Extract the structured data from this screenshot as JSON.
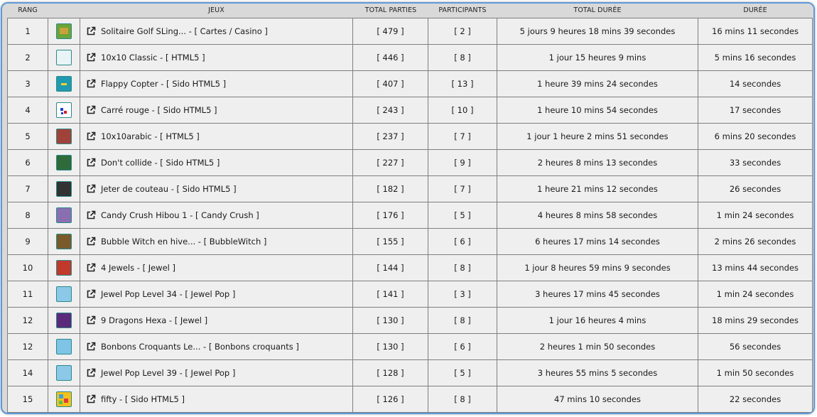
{
  "header": {
    "rang": "RANG",
    "jeux": "JEUX",
    "total_parties": "TOTAL PARTIES",
    "participants": "PARTICIPANTS",
    "total_duree": "TOTAL DURÉE",
    "duree": "DURÉE"
  },
  "rows": [
    {
      "rang": "1",
      "jeu": "Solitaire Golf SLing... - [ Cartes / Casino ]",
      "parties": "[ 479 ]",
      "participants": "[ 2 ]",
      "total_duree": "5 jours 9 heures 18 mins 39 secondes",
      "duree": "16 mins 11 secondes",
      "thumb_color": "#6aa43a"
    },
    {
      "rang": "2",
      "jeu": "10x10 Classic - [ HTML5 ]",
      "parties": "[ 446 ]",
      "participants": "[ 8 ]",
      "total_duree": "1 jour 15 heures 9 mins",
      "duree": "5 mins 16 secondes",
      "thumb_color": "#e8f4f6"
    },
    {
      "rang": "3",
      "jeu": "Flappy Copter - [ Sido HTML5 ]",
      "parties": "[ 407 ]",
      "participants": "[ 13 ]",
      "total_duree": "1 heure 39 mins 24 secondes",
      "duree": "14 secondes",
      "thumb_color": "#1f9ab0"
    },
    {
      "rang": "4",
      "jeu": "Carré rouge - [ Sido HTML5 ]",
      "parties": "[ 243 ]",
      "participants": "[ 10 ]",
      "total_duree": "1 heure 10 mins 54 secondes",
      "duree": "17 secondes",
      "thumb_color": "#ffffff"
    },
    {
      "rang": "5",
      "jeu": "10x10arabic - [ HTML5 ]",
      "parties": "[ 237 ]",
      "participants": "[ 7 ]",
      "total_duree": "1 jour 1 heure 2 mins 51 secondes",
      "duree": "6 mins 20 secondes",
      "thumb_color": "#a0413a"
    },
    {
      "rang": "6",
      "jeu": "Don't collide - [ Sido HTML5 ]",
      "parties": "[ 227 ]",
      "participants": "[ 9 ]",
      "total_duree": "2 heures 8 mins 13 secondes",
      "duree": "33 secondes",
      "thumb_color": "#2f6b3a"
    },
    {
      "rang": "7",
      "jeu": "Jeter de couteau - [ Sido HTML5 ]",
      "parties": "[ 182 ]",
      "participants": "[ 7 ]",
      "total_duree": "1 heure 21 mins 12 secondes",
      "duree": "26 secondes",
      "thumb_color": "#333333"
    },
    {
      "rang": "8",
      "jeu": "Candy Crush Hibou 1 - [ Candy Crush ]",
      "parties": "[ 176 ]",
      "participants": "[ 5 ]",
      "total_duree": "4 heures 8 mins 58 secondes",
      "duree": "1 min 24 secondes",
      "thumb_color": "#8a6fb0"
    },
    {
      "rang": "9",
      "jeu": "Bubble Witch en hive... - [ BubbleWitch ]",
      "parties": "[ 155 ]",
      "participants": "[ 6 ]",
      "total_duree": "6 heures 17 mins 14 secondes",
      "duree": "2 mins 26 secondes",
      "thumb_color": "#7a5a2a"
    },
    {
      "rang": "10",
      "jeu": "4 Jewels - [ Jewel ]",
      "parties": "[ 144 ]",
      "participants": "[ 8 ]",
      "total_duree": "1 jour 8 heures 59 mins 9 secondes",
      "duree": "13 mins 44 secondes",
      "thumb_color": "#c0392b"
    },
    {
      "rang": "11",
      "jeu": "Jewel Pop Level 34 - [ Jewel Pop ]",
      "parties": "[ 141 ]",
      "participants": "[ 3 ]",
      "total_duree": "3 heures 17 mins 45 secondes",
      "duree": "1 min 24 secondes",
      "thumb_color": "#8cc8e8"
    },
    {
      "rang": "12",
      "jeu": "9 Dragons Hexa - [ Jewel ]",
      "parties": "[ 130 ]",
      "participants": "[ 8 ]",
      "total_duree": "1 jour 16 heures 4 mins",
      "duree": "18 mins 29 secondes",
      "thumb_color": "#5b2a7a"
    },
    {
      "rang": "12",
      "jeu": "Bonbons Croquants Le... - [ Bonbons croquants ]",
      "parties": "[ 130 ]",
      "participants": "[ 6 ]",
      "total_duree": "2 heures 1 min 50 secondes",
      "duree": "56 secondes",
      "thumb_color": "#7fc3e6"
    },
    {
      "rang": "14",
      "jeu": "Jewel Pop Level 39 - [ Jewel Pop ]",
      "parties": "[ 128 ]",
      "participants": "[ 5 ]",
      "total_duree": "3 heures 55 mins 5 secondes",
      "duree": "1 min 50 secondes",
      "thumb_color": "#8cc8e8"
    },
    {
      "rang": "15",
      "jeu": "fifty - [ Sido HTML5 ]",
      "parties": "[ 126 ]",
      "participants": "[ 8 ]",
      "total_duree": "47 mins 10 secondes",
      "duree": "22 secondes",
      "thumb_color": "#f2c21b"
    }
  ]
}
